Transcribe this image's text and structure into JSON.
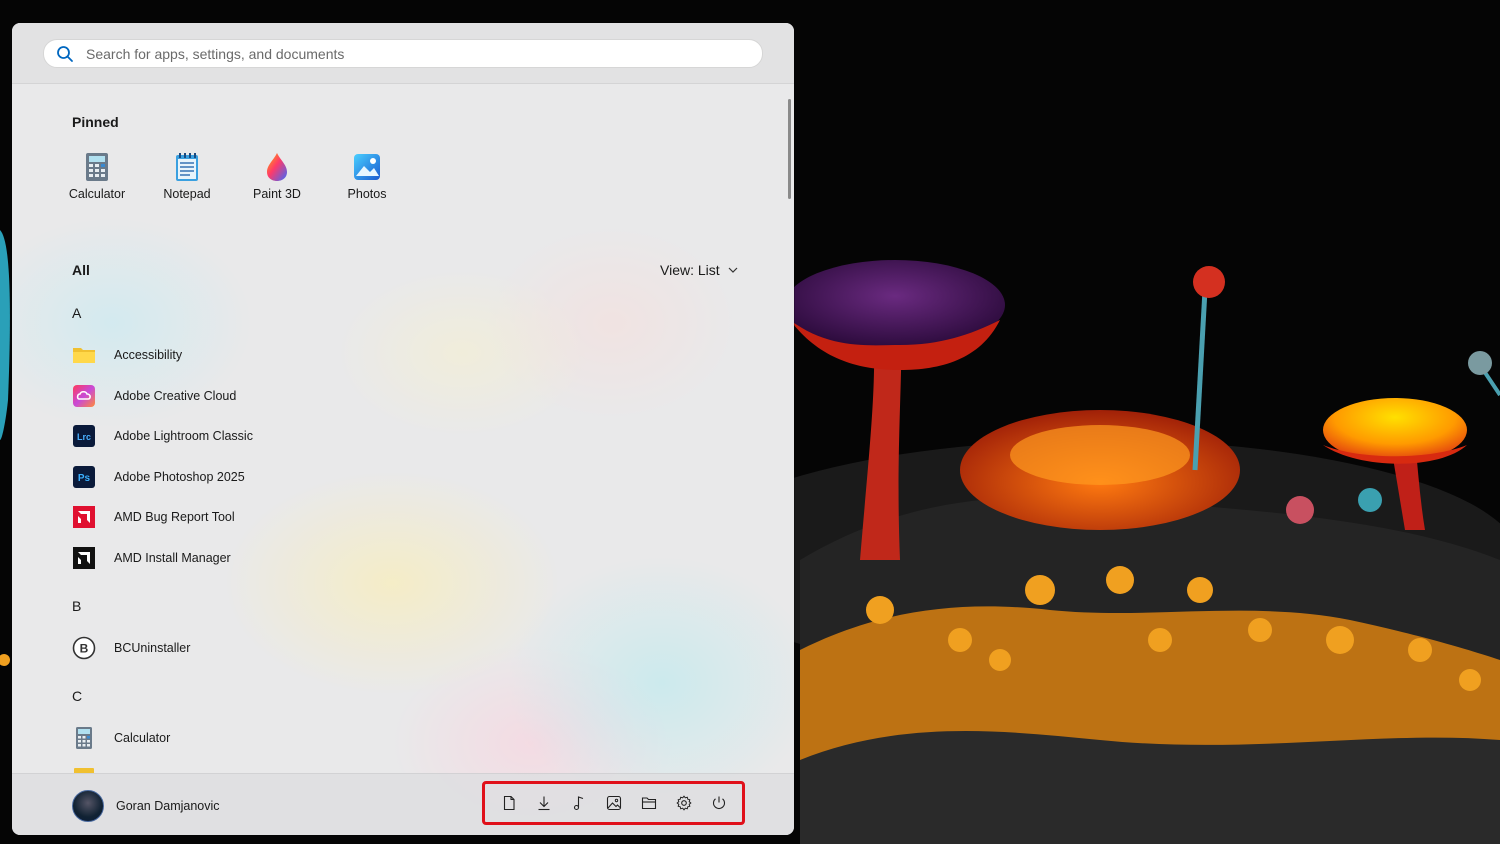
{
  "search": {
    "placeholder": "Search for apps, settings, and documents"
  },
  "pinned": {
    "title": "Pinned",
    "items": [
      {
        "label": "Calculator",
        "icon": "calculator-icon"
      },
      {
        "label": "Notepad",
        "icon": "notepad-icon"
      },
      {
        "label": "Paint 3D",
        "icon": "paint3d-icon"
      },
      {
        "label": "Photos",
        "icon": "photos-icon"
      }
    ]
  },
  "all": {
    "title": "All",
    "view_label": "View: List",
    "groups": [
      {
        "letter": "A",
        "apps": [
          {
            "label": "Accessibility",
            "icon": "folder-icon"
          },
          {
            "label": "Adobe Creative Cloud",
            "icon": "creative-cloud-icon"
          },
          {
            "label": "Adobe Lightroom Classic",
            "icon": "lightroom-icon",
            "glyph": "Lrc"
          },
          {
            "label": "Adobe Photoshop 2025",
            "icon": "photoshop-icon",
            "glyph": "Ps"
          },
          {
            "label": "AMD Bug Report Tool",
            "icon": "amd-icon"
          },
          {
            "label": "AMD Install Manager",
            "icon": "amd-install-icon"
          }
        ]
      },
      {
        "letter": "B",
        "apps": [
          {
            "label": "BCUninstaller",
            "icon": "bcuninstaller-icon",
            "glyph": "B"
          }
        ]
      },
      {
        "letter": "C",
        "apps": [
          {
            "label": "Calculator",
            "icon": "calculator-icon"
          }
        ]
      }
    ]
  },
  "user": {
    "name": "Goran Damjanovic"
  },
  "quick_access": [
    "document-icon",
    "downloads-icon",
    "music-icon",
    "pictures-icon",
    "file-explorer-icon",
    "settings-icon",
    "power-icon"
  ],
  "colors": {
    "highlight": "#e0101a",
    "accent": "#0067c0"
  }
}
